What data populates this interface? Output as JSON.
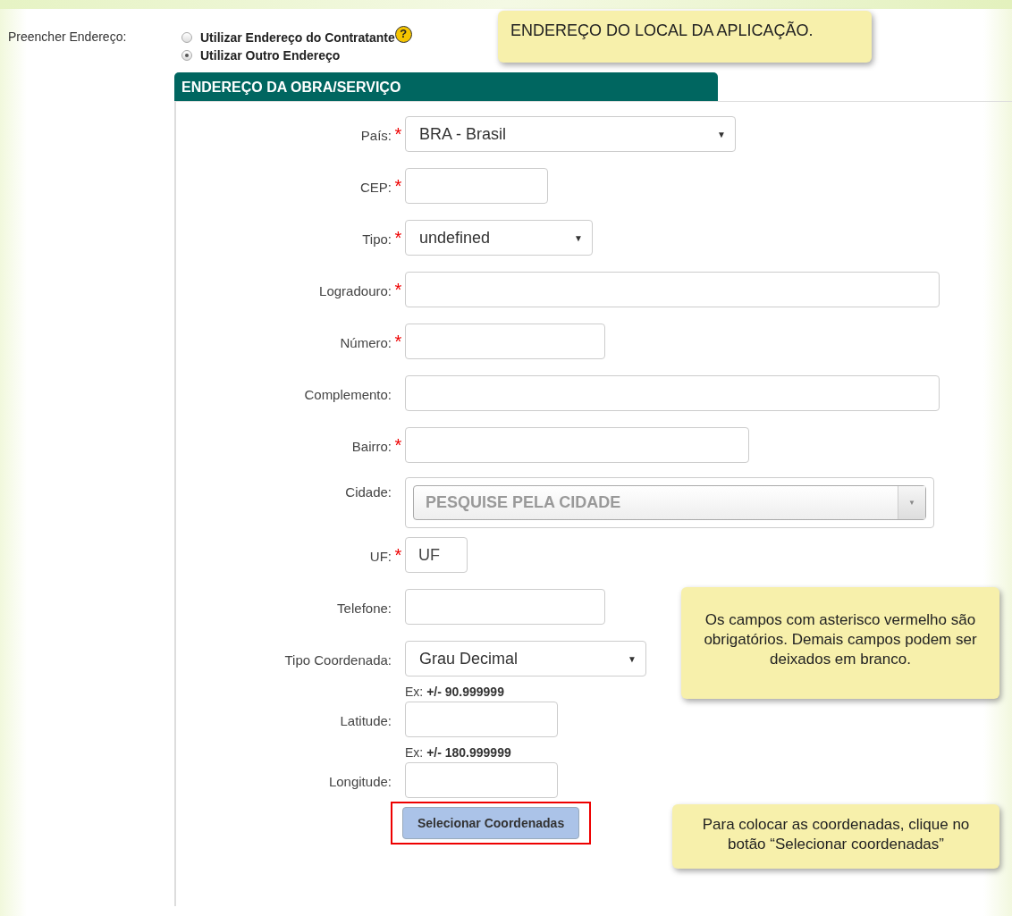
{
  "address_fill": {
    "label": "Preencher Endereço:",
    "options": [
      {
        "label": "Utilizar Endereço do Contratante",
        "selected": false,
        "help": "?"
      },
      {
        "label": "Utilizar Outro Endereço",
        "selected": true
      }
    ]
  },
  "notes": [
    {
      "text": "ENDEREÇO DO LOCAL DA APLICAÇÃO."
    },
    {
      "text": "Os campos com asterisco vermelho são obrigatórios. Demais campos podem ser deixados em branco."
    },
    {
      "text": "Para colocar as coordenadas, clique no botão “Selecionar coordenadas”"
    }
  ],
  "panel": {
    "title": "ENDEREÇO DA OBRA/SERVIÇO",
    "fields": [
      {
        "kind": "select",
        "label": "País:",
        "asterisk": "*",
        "value": "BRA - Brasil",
        "arrow": "▼"
      },
      {
        "kind": "input",
        "label": "CEP:",
        "asterisk": "*"
      },
      {
        "kind": "select",
        "label": "Tipo:",
        "asterisk": "*",
        "value": "undefined",
        "arrow": "▼"
      },
      {
        "kind": "input",
        "label": "Logradouro:",
        "asterisk": "*"
      },
      {
        "kind": "input",
        "label": "Número:",
        "asterisk": "*"
      },
      {
        "kind": "input",
        "label": "Complemento:"
      },
      {
        "kind": "input",
        "label": "Bairro:",
        "asterisk": "*"
      },
      {
        "kind": "combo",
        "label": "Cidade:",
        "placeholder": "PESQUISE PELA CIDADE",
        "arrow": "▼"
      },
      {
        "kind": "input",
        "label": "UF:",
        "asterisk": "*",
        "placeholder": "UF"
      },
      {
        "kind": "input",
        "label": "Telefone:"
      },
      {
        "kind": "select",
        "label": "Tipo Coordenada:",
        "value": "Grau Decimal",
        "arrow": "▼"
      },
      {
        "kind": "input",
        "label": "Latitude:",
        "hint": "Ex: **+/- 90.999999**"
      },
      {
        "kind": "input",
        "label": "Longitude:",
        "hint": "Ex: **+/- 180.999999**"
      }
    ],
    "button": {
      "label": "Selecionar Coordenadas",
      "highlighted": true
    }
  }
}
